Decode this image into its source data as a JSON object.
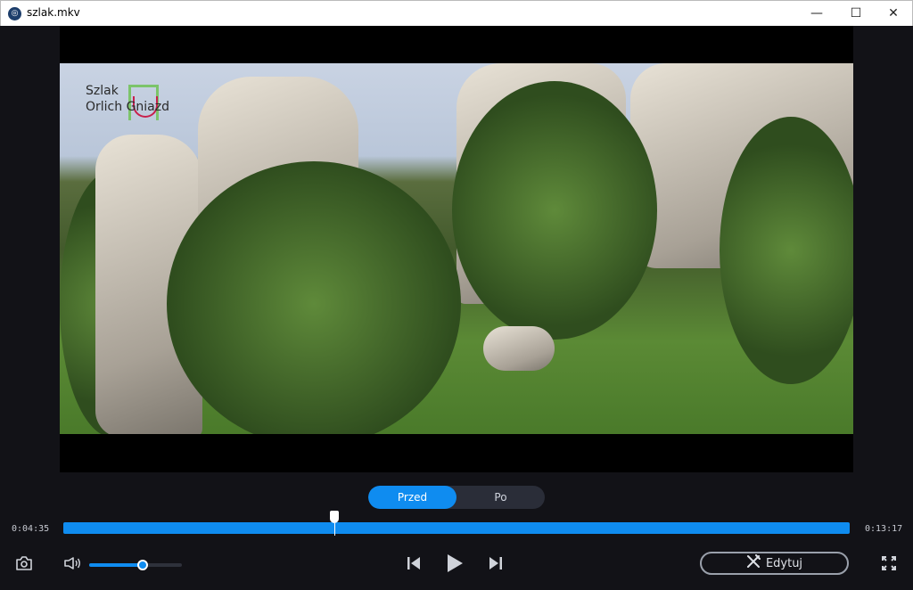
{
  "window": {
    "title": "szlak.mkv",
    "app_icon": "app-logo-icon"
  },
  "video": {
    "logo_text_line1": "Szlak",
    "logo_text_line2": "Orlich Gniazd"
  },
  "compare_toggle": {
    "options": [
      "Przed",
      "Po"
    ],
    "selected": "Przed"
  },
  "timeline": {
    "current_time": "0:04:35",
    "total_time": "0:13:17",
    "playhead_fraction": 0.345
  },
  "volume": {
    "level_fraction": 0.58
  },
  "controls": {
    "edit_label": "Edytuj"
  },
  "colors": {
    "accent": "#0f8cf0",
    "background": "#121217"
  }
}
